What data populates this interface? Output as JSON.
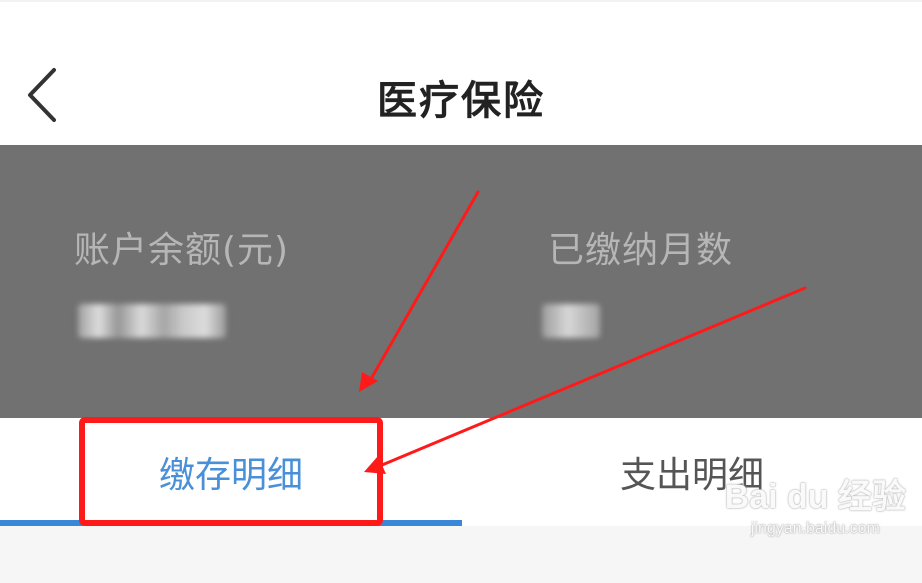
{
  "header": {
    "title": "医疗保险",
    "back_icon": "chevron-left-icon"
  },
  "summary": {
    "balance_label": "账户余额(元)",
    "months_label": "已缴纳月数"
  },
  "tabs": [
    {
      "label": "缴存明细",
      "active": true
    },
    {
      "label": "支出明细",
      "active": false
    }
  ],
  "colors": {
    "summary_bg": "#717171",
    "active_tab": "#4a90d9",
    "inactive_tab": "#555555",
    "annotation": "#ff1a1a"
  },
  "watermark": {
    "brand": "Bai du 经验",
    "url": "jingyan.baidu.com"
  }
}
